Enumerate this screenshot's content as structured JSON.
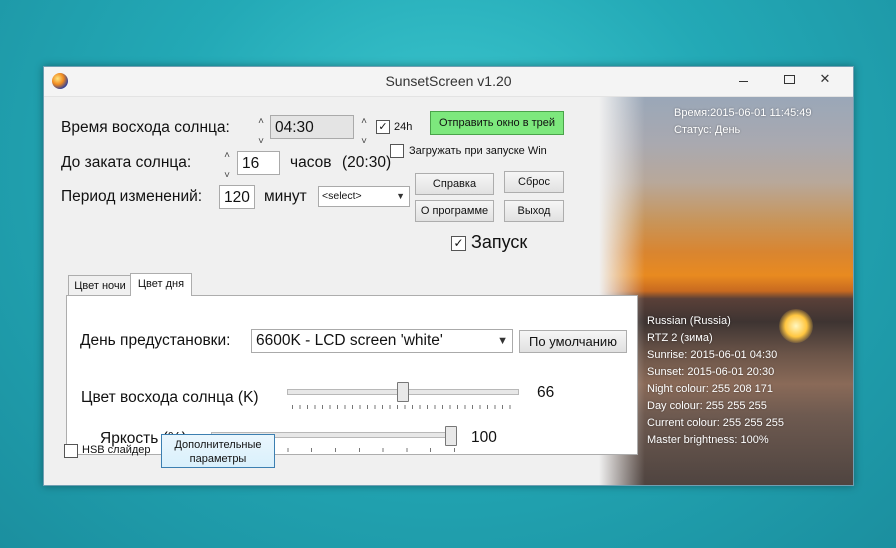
{
  "window": {
    "title": "SunsetScreen v1.20"
  },
  "sunrise": {
    "label": "Время восхода солнца:",
    "value": "04:30",
    "h24_label": "24h",
    "h24_checked": true
  },
  "sunset": {
    "label": "До заката солнца:",
    "hours": "16",
    "hours_label": "часов",
    "time": "(20:30)"
  },
  "period": {
    "label": "Период изменений:",
    "value": "120",
    "unit": "минут",
    "select": "<select>"
  },
  "buttons": {
    "tray": "Отправить окно в трей",
    "help": "Справка",
    "reset": "Сброс",
    "about": "О программе",
    "exit": "Выход",
    "defaults": "По умолчанию",
    "advanced_line1": "Дополнительные",
    "advanced_line2": "параметры"
  },
  "autostart": {
    "label": "Загружать при запуске Win",
    "checked": false
  },
  "run": {
    "label": "Запуск",
    "checked": true
  },
  "tabs": [
    {
      "label": "Цвет ночи"
    },
    {
      "label": "Цвет дня"
    }
  ],
  "day": {
    "preset_label": "День предустановки:",
    "preset_value": "6600K - LCD screen 'white'",
    "sunrise_color_label": "Цвет восхода солнца (K)",
    "sunrise_color_value": "66",
    "brightness_label": "Яркость (%)",
    "brightness_value": "100"
  },
  "hsb": {
    "label": "HSB слайдер",
    "checked": false
  },
  "info": {
    "time": "Время:2015-06-01 11:45:49",
    "status": "Статус: День",
    "lines": [
      "Russian (Russia)",
      "RTZ 2 (зима)",
      "Sunrise: 2015-06-01 04:30",
      "Sunset: 2015-06-01 20:30",
      "Night colour: 255 208 171",
      "Day colour: 255 255 255",
      "Current colour: 255 255 255",
      "Master brightness: 100%"
    ]
  }
}
